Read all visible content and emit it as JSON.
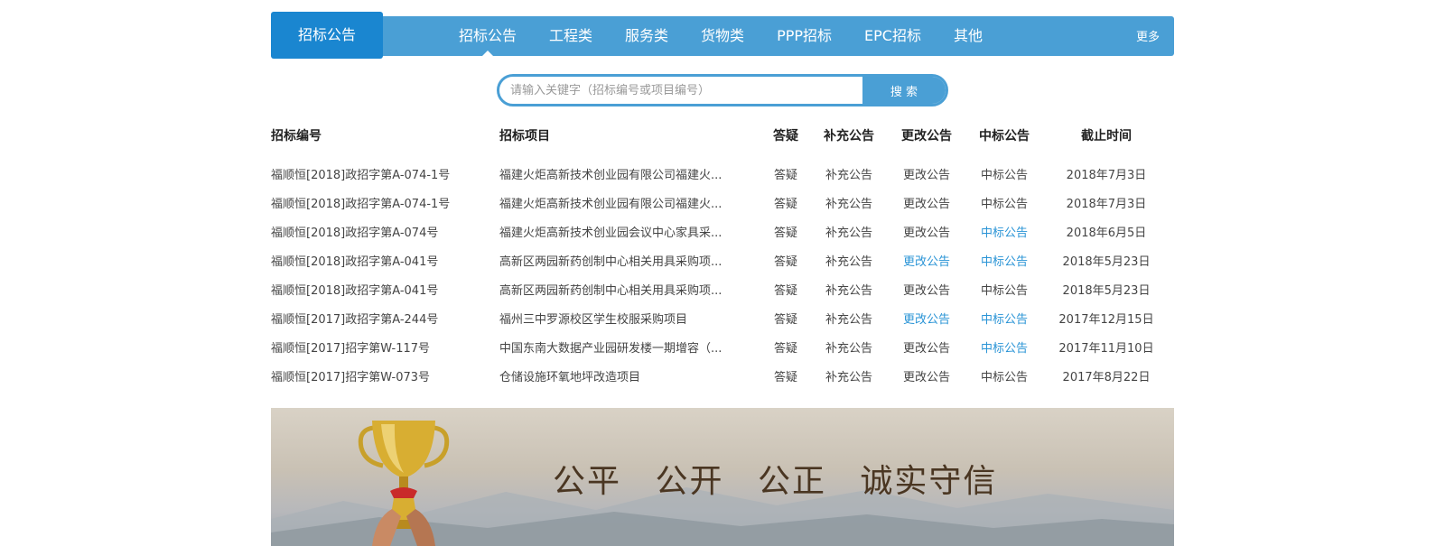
{
  "brand": "招标公告",
  "tabs": [
    "招标公告",
    "工程类",
    "服务类",
    "货物类",
    "PPP招标",
    "EPC招标",
    "其他"
  ],
  "more": "更多",
  "search": {
    "placeholder": "请输入关键字（招标编号或项目编号）",
    "button": "搜 索"
  },
  "table": {
    "headers": [
      "招标编号",
      "招标项目",
      "答疑",
      "补充公告",
      "更改公告",
      "中标公告",
      "截止时间"
    ],
    "rows": [
      {
        "code": "福顺恒[2018]政招字第A-074-1号",
        "project": "福建火炬高新技术创业园有限公司福建火...",
        "qa": "答疑",
        "supp": "补充公告",
        "change": "更改公告",
        "award": "中标公告",
        "deadline": "2018年7月3日"
      },
      {
        "code": "福顺恒[2018]政招字第A-074-1号",
        "project": "福建火炬高新技术创业园有限公司福建火...",
        "qa": "答疑",
        "supp": "补充公告",
        "change": "更改公告",
        "award": "中标公告",
        "deadline": "2018年7月3日"
      },
      {
        "code": "福顺恒[2018]政招字第A-074号",
        "project": "福建火炬高新技术创业园会议中心家具采...",
        "qa": "答疑",
        "supp": "补充公告",
        "change": "更改公告",
        "award": "中标公告",
        "deadline": "2018年6月5日"
      },
      {
        "code": "福顺恒[2018]政招字第A-041号",
        "project": "高新区两园新药创制中心相关用具采购项...",
        "qa": "答疑",
        "supp": "补充公告",
        "change": "更改公告",
        "award": "中标公告",
        "deadline": "2018年5月23日"
      },
      {
        "code": "福顺恒[2018]政招字第A-041号",
        "project": "高新区两园新药创制中心相关用具采购项...",
        "qa": "答疑",
        "supp": "补充公告",
        "change": "更改公告",
        "award": "中标公告",
        "deadline": "2018年5月23日"
      },
      {
        "code": "福顺恒[2017]政招字第A-244号",
        "project": "福州三中罗源校区学生校服采购项目",
        "qa": "答疑",
        "supp": "补充公告",
        "change": "更改公告",
        "award": "中标公告",
        "deadline": "2017年12月15日"
      },
      {
        "code": "福顺恒[2017]招字第W-117号",
        "project": "中国东南大数据产业园研发楼一期增容（...",
        "qa": "答疑",
        "supp": "补充公告",
        "change": "更改公告",
        "award": "中标公告",
        "deadline": "2017年11月10日"
      },
      {
        "code": "福顺恒[2017]招字第W-073号",
        "project": "仓储设施环氧地坪改造项目",
        "qa": "答疑",
        "supp": "补充公告",
        "change": "更改公告",
        "award": "中标公告",
        "deadline": "2017年8月22日"
      }
    ]
  },
  "banner": {
    "slogan": [
      "公平",
      "公开",
      "公正",
      "诚实守信"
    ]
  },
  "colors": {
    "nav": "#4a9fd5",
    "brand": "#1a86d0",
    "link_highlight": "#2a94d6"
  }
}
